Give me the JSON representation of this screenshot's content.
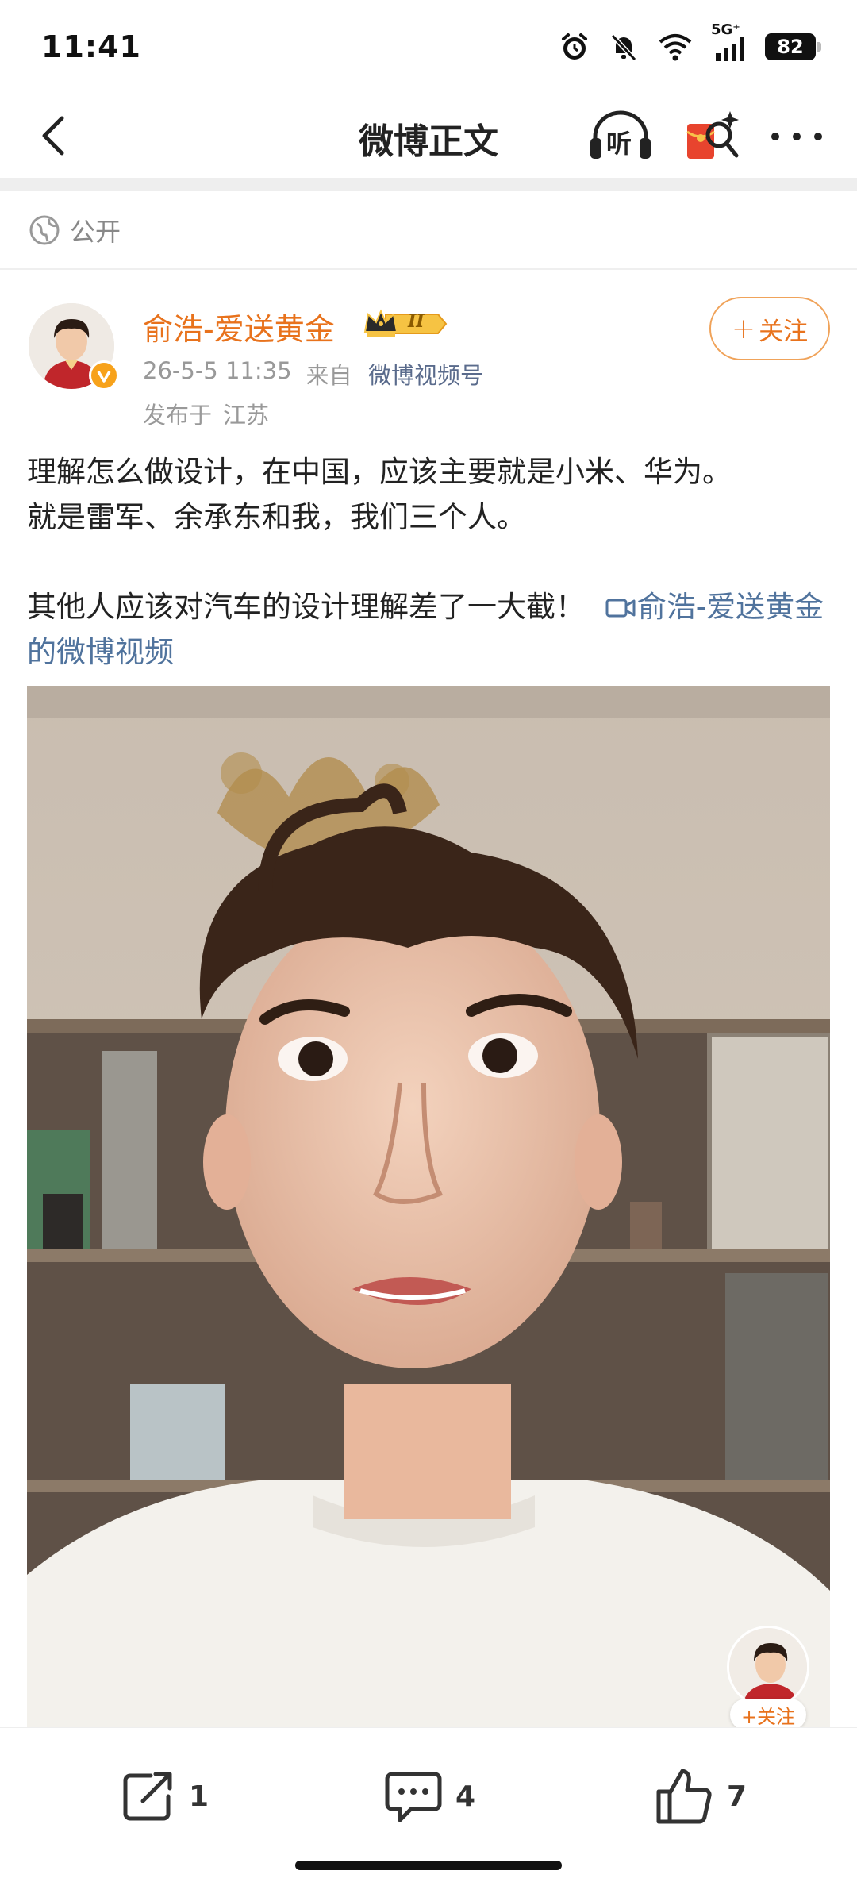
{
  "status_bar": {
    "time": "11:41",
    "network": "5G⁺",
    "battery": "82",
    "icons": [
      "alarm-icon",
      "mute-bell-icon",
      "wifi-icon",
      "signal-icon",
      "battery-icon"
    ]
  },
  "nav": {
    "title": "微博正文",
    "listen_label": "听",
    "icons": [
      "back-icon",
      "listen-icon",
      "red-packet-icon",
      "more-icon"
    ]
  },
  "visibility": {
    "label": "公开"
  },
  "author": {
    "name": "俞浩-爱送黄金",
    "badge_label": "II",
    "date": "26-5-5 11:35",
    "source_prefix": "来自",
    "source": "微博视频号",
    "location_prefix": "发布于",
    "location": "江苏",
    "follow_label": "关注"
  },
  "post": {
    "line1": "理解怎么做设计，在中国，应该主要就是小米、华为。",
    "line2": "就是雷军、余承东和我，我们三个人。",
    "line3": "其他人应该对汽车的设计理解差了一大截！",
    "video_link": "俞浩-爱送黄金的微博视频"
  },
  "video_overlay": {
    "follow_label": "+关注"
  },
  "actions": {
    "repost_count": "1",
    "comment_count": "4",
    "like_count": "7"
  },
  "colors": {
    "accent_orange": "#e8721c",
    "link_blue": "#50739d",
    "meta_gray": "#999999"
  }
}
